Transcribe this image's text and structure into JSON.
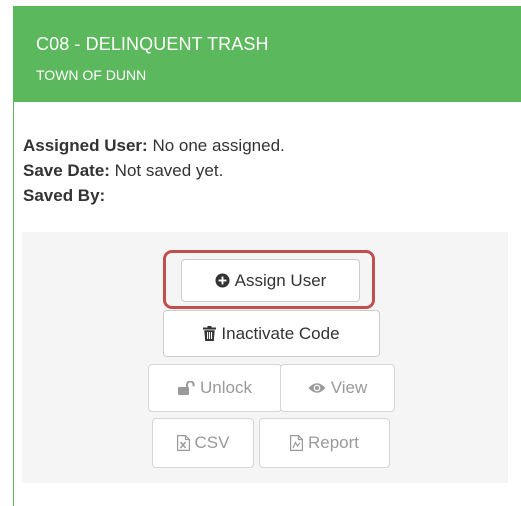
{
  "panel": {
    "title": "C08 - DELINQUENT TRASH",
    "subtitle": "TOWN OF DUNN",
    "header_color": "#5cb85c"
  },
  "details": {
    "assigned_user_label": "Assigned User:",
    "assigned_user_value": "No one assigned.",
    "save_date_label": "Save Date:",
    "save_date_value": "Not saved yet.",
    "saved_by_label": "Saved By:",
    "saved_by_value": ""
  },
  "actions": {
    "assign_user": {
      "label": "Assign User",
      "icon": "plus-circle-icon"
    },
    "inactivate_code": {
      "label": "Inactivate Code",
      "icon": "trash-icon"
    },
    "unlock": {
      "label": "Unlock",
      "icon": "unlock-icon",
      "disabled": true
    },
    "view": {
      "label": "View",
      "icon": "eye-icon",
      "disabled": true
    },
    "csv": {
      "label": "CSV",
      "icon": "excel-file-icon",
      "disabled": true
    },
    "report": {
      "label": "Report",
      "icon": "pdf-file-icon",
      "disabled": true
    }
  },
  "highlight_color": "#c0504d"
}
